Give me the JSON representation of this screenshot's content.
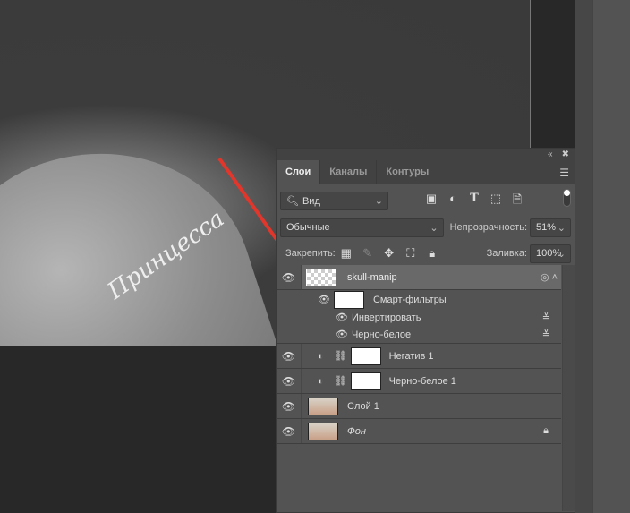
{
  "panel": {
    "collapse_icon": "«",
    "close_icon": "✖",
    "tabs": [
      {
        "label": "Слои",
        "active": true
      },
      {
        "label": "Каналы"
      },
      {
        "label": "Контуры"
      }
    ],
    "filter": {
      "label": "Вид"
    },
    "blend_mode": "Обычные",
    "opacity_label": "Непрозрачность:",
    "opacity_value": "51%",
    "lock_label": "Закрепить:",
    "fill_label": "Заливка:",
    "fill_value": "100%",
    "layers": [
      {
        "name": "skull-manip",
        "type": "smart-object",
        "selected": true
      },
      {
        "name": "Смарт-фильтры",
        "type": "smart-filters"
      },
      {
        "name": "Инвертировать",
        "type": "filter"
      },
      {
        "name": "Черно-белое",
        "type": "filter"
      },
      {
        "name": "Негатив 1",
        "type": "adjustment"
      },
      {
        "name": "Черно-белое 1",
        "type": "adjustment"
      },
      {
        "name": "Слой 1",
        "type": "pixel"
      },
      {
        "name": "Фон",
        "type": "background",
        "locked": true
      }
    ]
  },
  "canvas": {
    "tattoo_text": "Принцесса"
  },
  "colors": {
    "arrow": "#e0362b",
    "panel": "#535353",
    "selected": "#696969"
  }
}
